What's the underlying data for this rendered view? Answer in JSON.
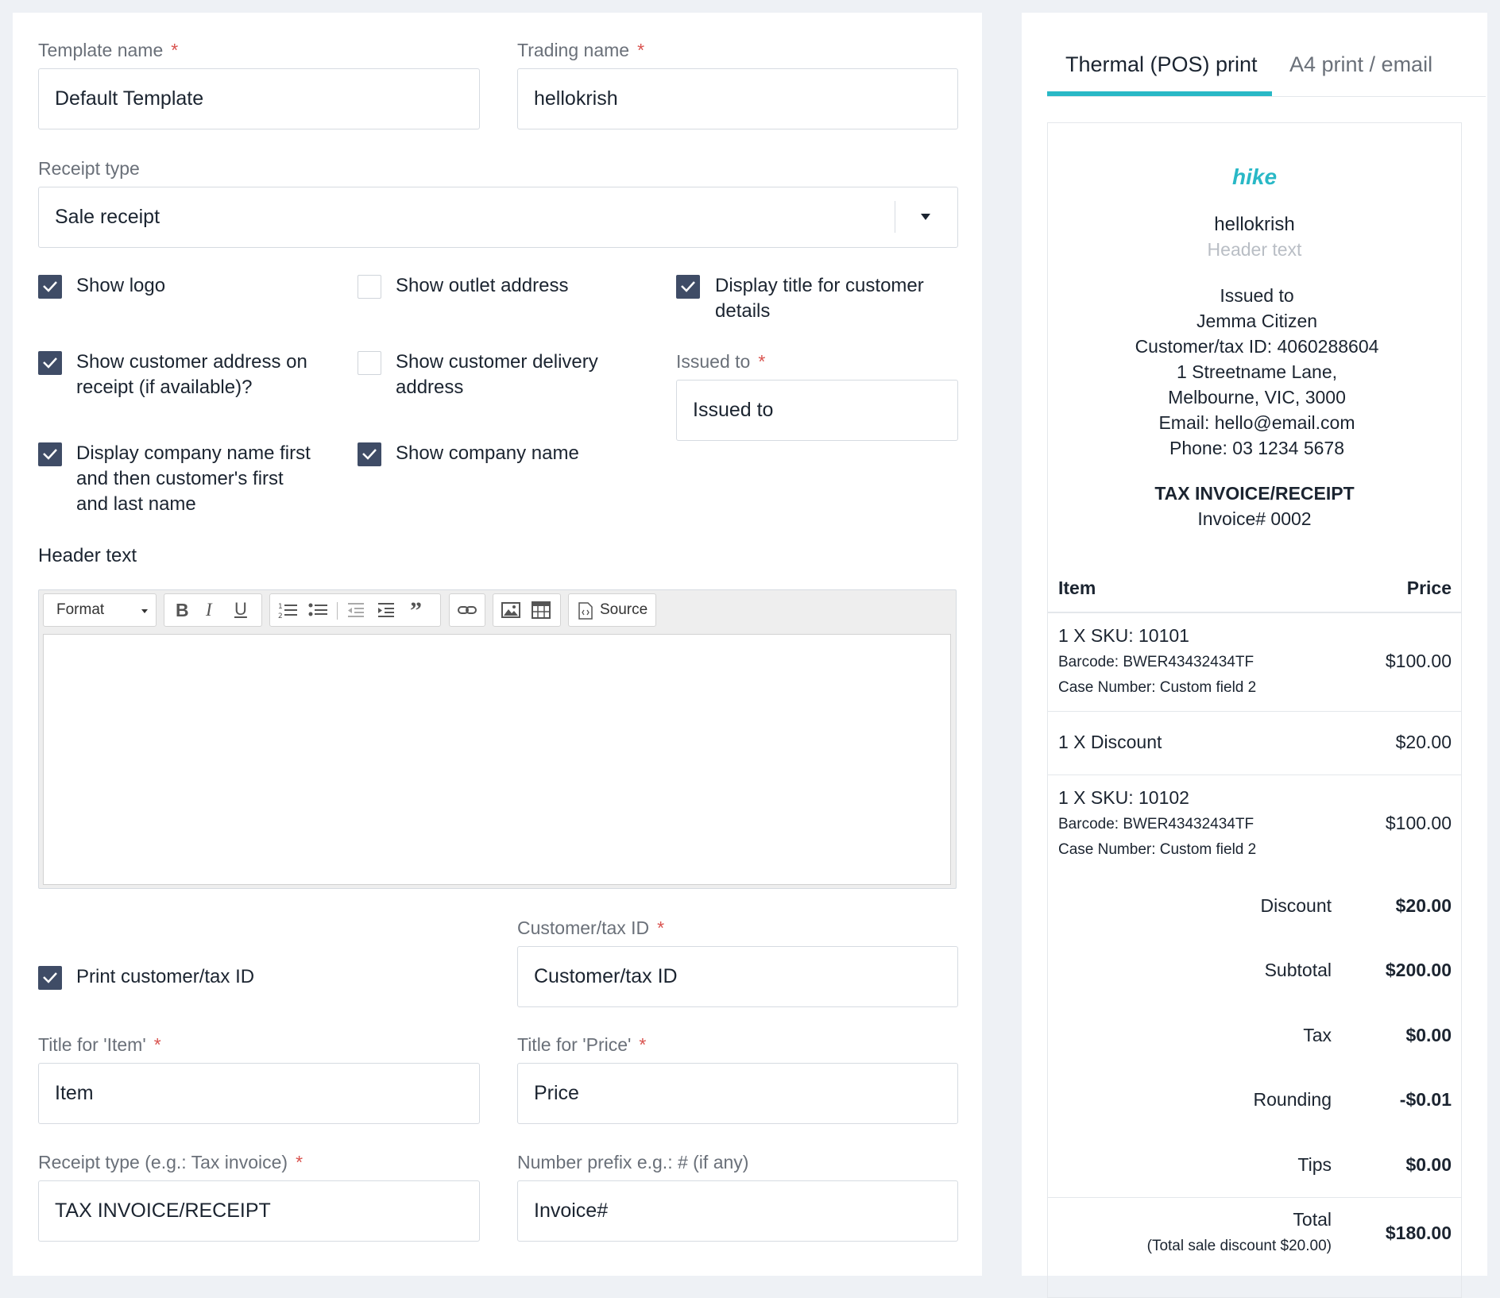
{
  "form": {
    "template_name": {
      "label": "Template name",
      "value": "Default Template"
    },
    "trading_name": {
      "label": "Trading name",
      "value": "hellokrish"
    },
    "receipt_type": {
      "label": "Receipt type",
      "value": "Sale receipt"
    },
    "required_mark": "*",
    "checkboxes": {
      "show_logo": {
        "label": "Show logo",
        "checked": true
      },
      "show_outlet_address": {
        "label": "Show outlet address",
        "checked": false
      },
      "display_title": {
        "label_line1": "Display title for customer",
        "label_line2": "details",
        "checked": true
      },
      "show_customer_address": {
        "label_line1": "Show customer address on",
        "label_line2": "receipt (if available)?",
        "checked": true
      },
      "show_delivery_address": {
        "label_line1": "Show customer delivery",
        "label_line2": "address",
        "checked": false
      },
      "company_name_first": {
        "label_line1": "Display company name first",
        "label_line2": "and then customer's first",
        "label_line3": "and last name",
        "checked": true
      },
      "show_company_name": {
        "label": "Show company name",
        "checked": true
      },
      "print_tax_id": {
        "label": "Print customer/tax ID",
        "checked": true
      }
    },
    "issued_to": {
      "label": "Issued to",
      "value": "Issued to"
    },
    "header_text": {
      "label": "Header text"
    },
    "editor": {
      "format_label": "Format",
      "source_label": "Source"
    },
    "customer_tax_id": {
      "label": "Customer/tax ID",
      "value": "Customer/tax ID"
    },
    "title_item": {
      "label": "Title for 'Item'",
      "value": "Item"
    },
    "title_price": {
      "label": "Title for 'Price'",
      "value": "Price"
    },
    "receipt_type_title": {
      "label": "Receipt type (e.g.: Tax invoice)",
      "value": "TAX INVOICE/RECEIPT"
    },
    "number_prefix": {
      "label": "Number prefix e.g.: # (if any)",
      "value": "Invoice#"
    }
  },
  "preview": {
    "tabs": [
      "Thermal (POS) print",
      "A4 print / email"
    ],
    "active_tab": 0,
    "accent_color": "#29b8c6",
    "logo_text": "hike",
    "business_name": "hellokrish",
    "header_placeholder": "Header text",
    "customer": {
      "issued_to": "Issued to",
      "name": "Jemma Citizen",
      "tax_id": "Customer/tax ID: 4060288604",
      "address1": "1 Streetname Lane,",
      "address2": "Melbourne, VIC, 3000",
      "email": "Email: hello@email.com",
      "phone": "Phone: 03 1234 5678"
    },
    "doc_title": "TAX INVOICE/RECEIPT",
    "invoice_no": "Invoice# 0002",
    "col_item": "Item",
    "col_price": "Price",
    "lines": [
      {
        "title": "1 X SKU: 10101",
        "barcode": "Barcode: BWER43432434TF",
        "case": "Case Number: Custom field 2",
        "price": "$100.00"
      },
      {
        "title": "1 X Discount",
        "price": "$20.00"
      },
      {
        "title": "1 X SKU: 10102",
        "barcode": "Barcode: BWER43432434TF",
        "case": "Case Number: Custom field 2",
        "price": "$100.00"
      }
    ],
    "totals": [
      {
        "label": "Discount",
        "value": "$20.00"
      },
      {
        "label": "Subtotal",
        "value": "$200.00"
      },
      {
        "label": "Tax",
        "value": "$0.00"
      },
      {
        "label": "Rounding",
        "value": "-$0.01"
      },
      {
        "label": "Tips",
        "value": "$0.00"
      }
    ],
    "total": {
      "label": "Total",
      "note": "(Total sale discount $20.00)",
      "value": "$180.00"
    }
  }
}
